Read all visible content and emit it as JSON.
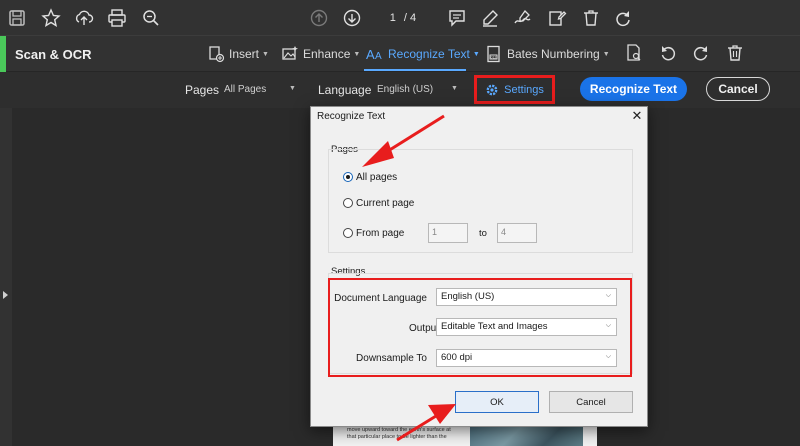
{
  "topbar": {
    "icons": [
      "save-icon",
      "star-icon",
      "cloud-upload-icon",
      "print-icon",
      "zoom-icon",
      "arrow-up-circle-icon",
      "arrow-down-circle-icon",
      "comment-icon",
      "highlight-icon",
      "sign-icon",
      "edit-icon",
      "trash-icon",
      "redo-icon"
    ],
    "page_current": "1",
    "page_total": "/ 4"
  },
  "toolbar2": {
    "title": "Scan & OCR",
    "insert_label": "Insert",
    "enhance_label": "Enhance",
    "recognize_label": "Recognize Text",
    "bates_label": "Bates Numbering",
    "accent_color": "#4ac85a",
    "active_color": "#5aa9ff"
  },
  "optbar": {
    "pages_label": "Pages",
    "pages_value": "All Pages",
    "language_label": "Language",
    "language_value": "English (US)",
    "settings_label": "Settings",
    "recognize_button": "Recognize Text",
    "cancel_button": "Cancel",
    "button_color": "#1a73e8"
  },
  "page_preview": {
    "text_line1": "move upward toward the earth's surface at",
    "text_line2": "that particular place to be lighter than the"
  },
  "dialog": {
    "title": "Recognize Text",
    "close_glyph": "✕",
    "pages_group": "Pages",
    "radio_all": "All pages",
    "radio_current": "Current page",
    "radio_from": "From page",
    "from_value": "1",
    "to_label": "to",
    "to_value": "4",
    "settings_group": "Settings",
    "doc_language_label": "Document Language",
    "doc_language_value": "English (US)",
    "output_label": "Output",
    "output_value": "Editable Text and Images",
    "downsample_label": "Downsample To",
    "downsample_value": "600 dpi",
    "ok_button": "OK",
    "cancel_button": "Cancel"
  },
  "annotation_color": "#e81d1d"
}
